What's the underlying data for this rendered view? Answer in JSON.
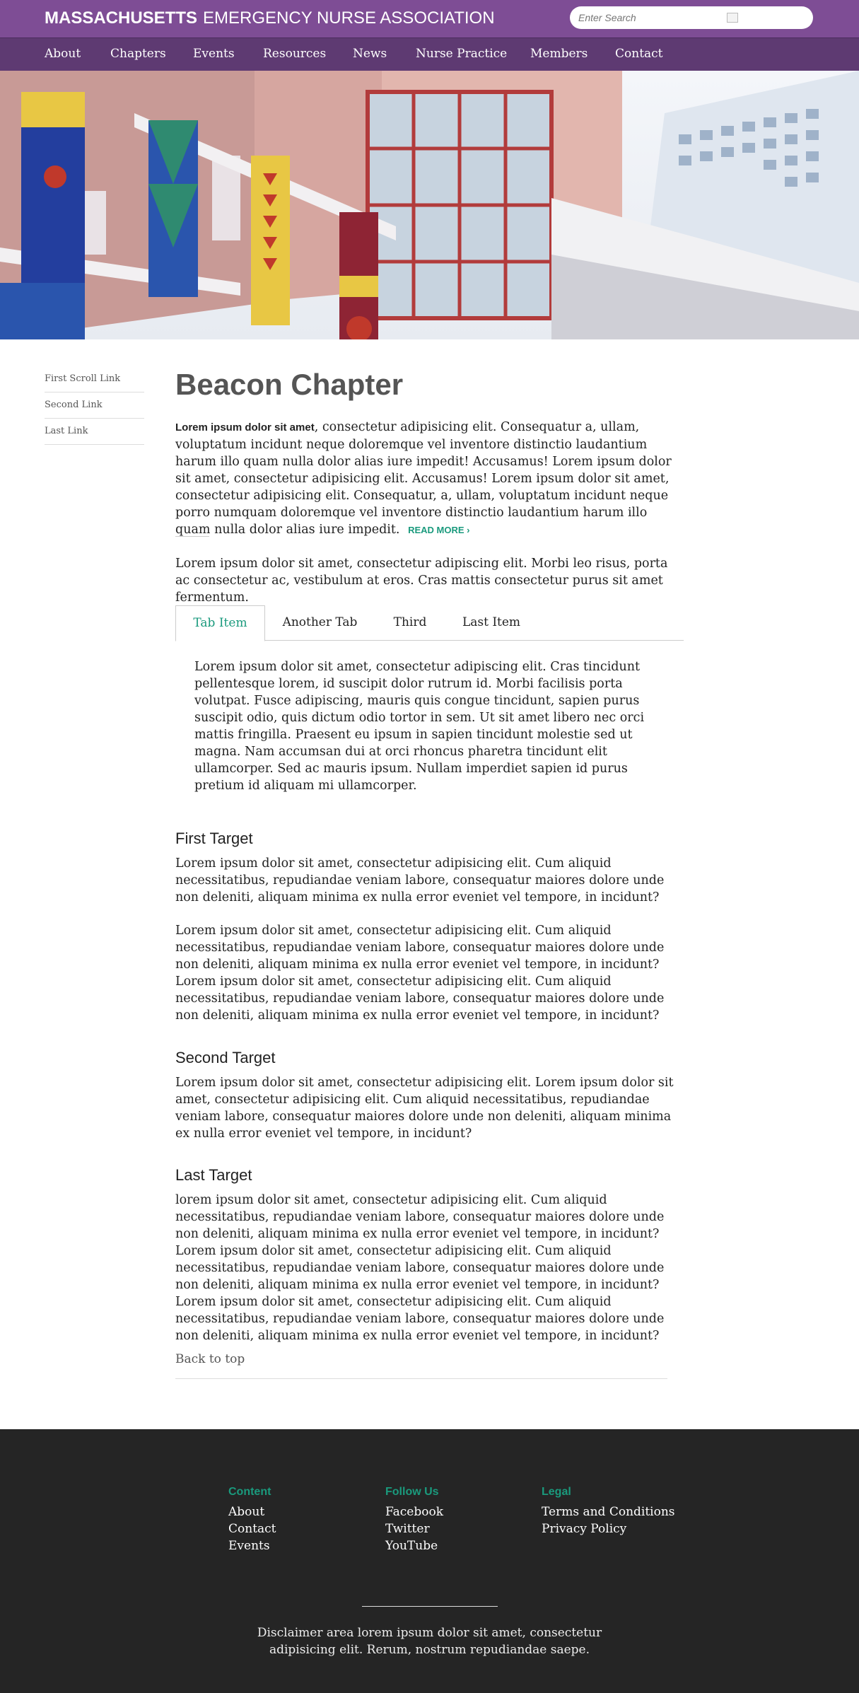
{
  "header": {
    "brand_strong": "MASSACHUSETTS",
    "brand_light": "EMERGENCY NURSE ASSOCIATION",
    "search_placeholder": "Enter Search",
    "purple": "#7e4d95",
    "purple_dark": "#5e3a72"
  },
  "nav": [
    "About",
    "Chapters",
    "Events",
    "Resources",
    "News",
    "Nurse Practice",
    "Members",
    "Contact"
  ],
  "sidebar": [
    "First Scroll Link",
    "Second Link",
    "Last Link"
  ],
  "main": {
    "title": "Beacon Chapter",
    "intro_lead": "Lorem ipsum dolor sit amet",
    "intro_text": ", consectetur adipisicing elit. Consequatur a, ullam, voluptatum incidunt neque doloremque vel inventore distinctio laudantium harum illo quam nulla dolor alias iure impedit! Accusamus! Lorem ipsum dolor sit amet, consectetur adipisicing elit. Accusamus! Lorem ipsum dolor sit amet, consectetur adipisicing elit. Consequatur, a, ullam, voluptatum incidunt neque porro numquam doloremque vel inventore distinctio laudantium harum illo quam nulla dolor alias iure impedit.",
    "read_more": "Read More",
    "read_more_arrow": "›",
    "second_para": "Lorem ipsum dolor sit amet, consectetur adipiscing elit. Morbi leo risus, porta ac consectetur ac, vestibulum at eros. Cras mattis consectetur purus sit amet fermentum.",
    "tabs": [
      "Tab Item",
      "Another Tab",
      "Third",
      "Last Item"
    ],
    "tab_content": "Lorem ipsum dolor sit amet, consectetur adipiscing elit. Cras tincidunt pellentesque lorem, id suscipit dolor rutrum id. Morbi facilisis porta volutpat. Fusce adipiscing, mauris quis congue tincidunt, sapien purus suscipit odio, quis dictum odio tortor in sem. Ut sit amet libero nec orci mattis fringilla. Praesent eu ipsum in sapien tincidunt molestie sed ut magna. Nam accumsan dui at orci rhoncus pharetra tincidunt elit ullamcorper. Sed ac mauris ipsum. Nullam imperdiet sapien id purus pretium id aliquam mi ullamcorper.",
    "first_target": {
      "heading": "First Target",
      "p1": "Lorem ipsum dolor sit amet, consectetur adipisicing elit. Cum aliquid necessitatibus, repudiandae veniam labore, consequatur maiores dolore unde non deleniti, aliquam minima ex nulla error eveniet vel tempore, in incidunt?",
      "p2": "Lorem ipsum dolor sit amet, consectetur adipisicing elit. Cum aliquid necessitatibus, repudiandae veniam labore, consequatur maiores dolore unde non deleniti, aliquam minima ex nulla error eveniet vel tempore, in incidunt? Lorem ipsum dolor sit amet, consectetur adipisicing elit. Cum aliquid necessitatibus, repudiandae veniam labore, consequatur maiores dolore unde non deleniti, aliquam minima ex nulla error eveniet vel tempore, in incidunt?"
    },
    "second_target": {
      "heading": "Second Target",
      "p1": "Lorem ipsum dolor sit amet, consectetur adipisicing elit. Lorem ipsum dolor sit amet, consectetur adipisicing elit. Cum aliquid necessitatibus, repudiandae veniam labore, consequatur maiores dolore unde non deleniti, aliquam minima ex nulla error eveniet vel tempore, in incidunt?"
    },
    "last_target": {
      "heading": "Last Target",
      "p1": "lorem ipsum dolor sit amet, consectetur adipisicing elit. Cum aliquid necessitatibus, repudiandae veniam labore, consequatur maiores dolore unde non deleniti, aliquam minima ex nulla error eveniet vel tempore, in incidunt? Lorem ipsum dolor sit amet, consectetur adipisicing elit. Cum aliquid necessitatibus, repudiandae veniam labore, consequatur maiores dolore unde non deleniti, aliquam minima ex nulla error eveniet vel tempore, in incidunt? Lorem ipsum dolor sit amet, consectetur adipisicing elit. Cum aliquid necessitatibus, repudiandae veniam labore, consequatur maiores dolore unde non deleniti, aliquam minima ex nulla error eveniet vel tempore, in incidunt?"
    },
    "back_to_top": "Back to top"
  },
  "footer": {
    "accent": "#1a9a7d",
    "background": "#252525",
    "columns": [
      {
        "heading": "Content",
        "links": [
          "About",
          "Contact",
          "Events"
        ]
      },
      {
        "heading": "Follow Us",
        "links": [
          "Facebook",
          "Twitter",
          "YouTube"
        ]
      },
      {
        "heading": "Legal",
        "links": [
          "Terms and Conditions",
          "Privacy Policy"
        ]
      }
    ],
    "disclaimer": "Disclaimer area lorem ipsum dolor sit amet, consectetur adipisicing elit. Rerum, nostrum repudiandae saepe."
  }
}
